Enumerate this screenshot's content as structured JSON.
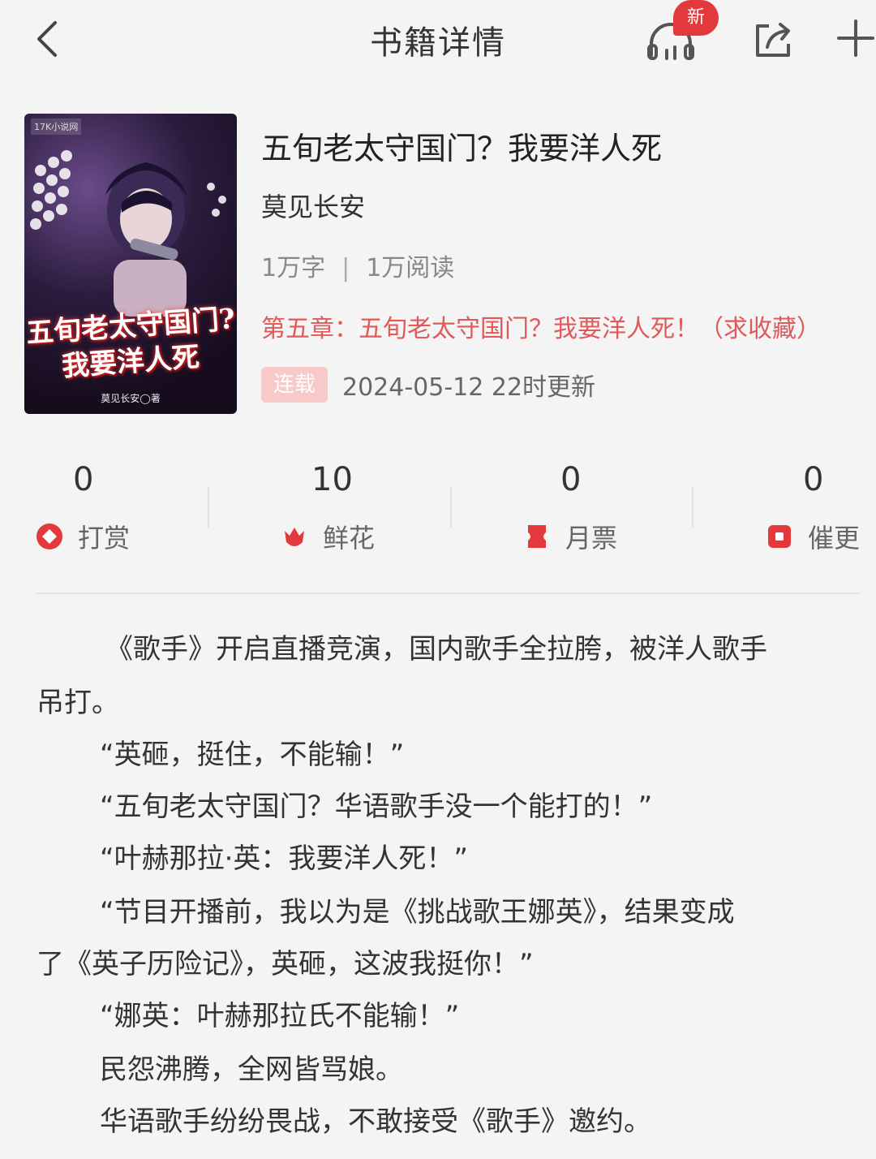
{
  "header": {
    "title": "书籍详情",
    "new_badge": "新"
  },
  "book": {
    "cover": {
      "publisher": "17K小说网",
      "title_line1": "五旬老太守国门?",
      "title_line2": "我要洋人死",
      "author": "莫见长安◯著"
    },
    "title": "五旬老太守国门？我要洋人死",
    "author": "莫见长安",
    "word_count": "1万字",
    "separator": "|",
    "reads": "1万阅读",
    "latest_chapter": "第五章：五旬老太守国门？我要洋人死！（求收藏）",
    "status": "连载",
    "updated": "2024-05-12 22时更新"
  },
  "stats": [
    {
      "value": "0",
      "label": "打赏",
      "icon": "reward-icon"
    },
    {
      "value": "10",
      "label": "鲜花",
      "icon": "flower-icon"
    },
    {
      "value": "0",
      "label": "月票",
      "icon": "ticket-icon"
    },
    {
      "value": "0",
      "label": "催更",
      "icon": "urge-icon"
    }
  ],
  "synopsis": [
    "《歌手》开启直播竞演，国内歌手全拉胯，被洋人歌手",
    "吊打。",
    "“英砸，挺住，不能输！”",
    "“五旬老太守国门？华语歌手没一个能打的！”",
    "“叶赫那拉·英：我要洋人死！”",
    "“节目开播前，我以为是《挑战歌王娜英》，结果变成",
    "了《英子历险记》，英砸，这波我挺你！”",
    "“娜英：叶赫那拉氏不能输！”",
    "民怨沸腾，全网皆骂娘。",
    "华语歌手纷纷畏战，不敢接受《歌手》邀约。"
  ],
  "colors": {
    "accent": "#e4393c",
    "chapter_text": "#e05a5a",
    "status_badge": "#f7c9c9"
  }
}
